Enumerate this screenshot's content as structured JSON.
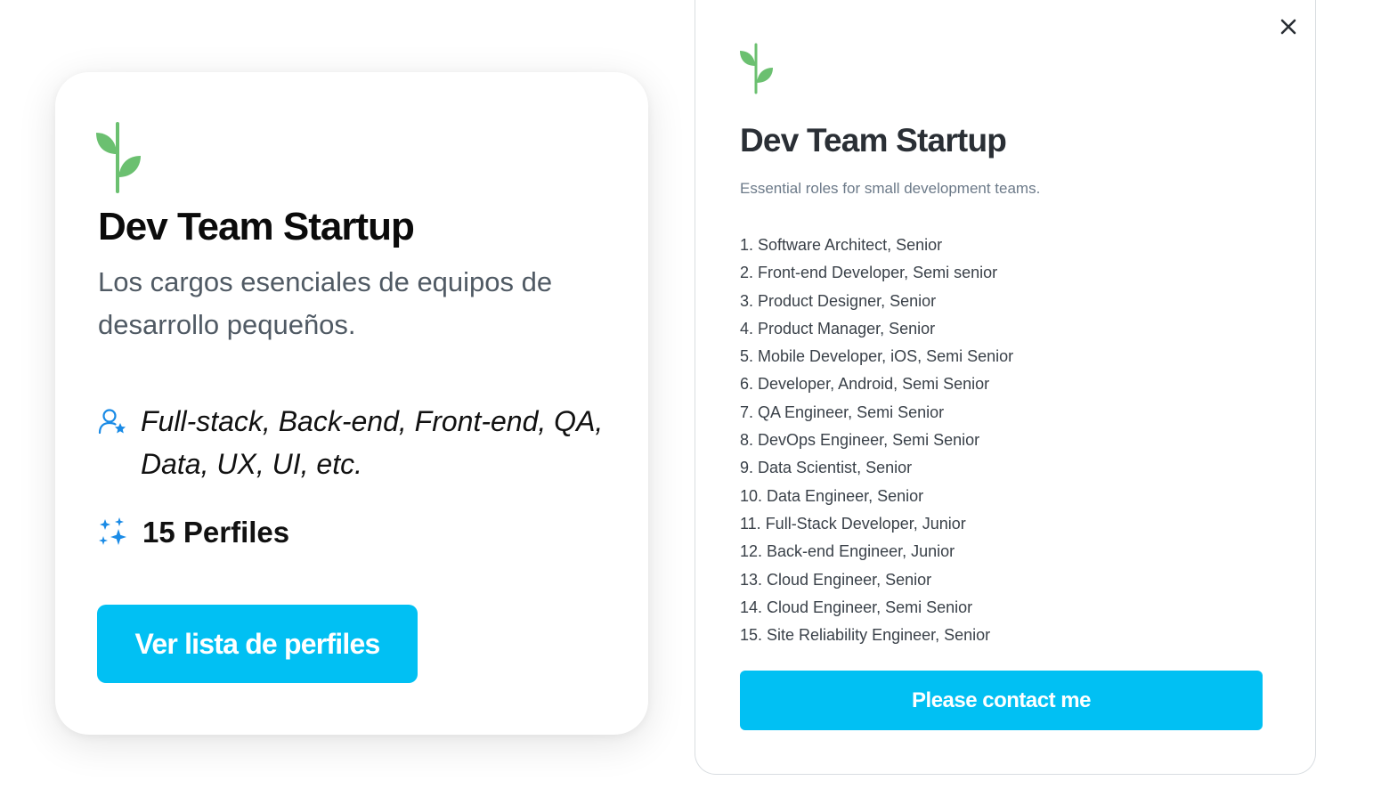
{
  "colors": {
    "accent": "#01c0f3",
    "leaf_green": "#6bc070",
    "icon_blue": "#1a8be6"
  },
  "card": {
    "logo_icon": "sprout-icon",
    "title": "Dev Team Startup",
    "description": "Los cargos esenciales de equipos de desarrollo pequeños.",
    "roles_icon": "user-star-icon",
    "roles": "Full-stack, Back-end, Front-end, QA, Data, UX, UI, etc.",
    "profiles_icon": "sparkles-icon",
    "profiles": "15 Perfiles",
    "button_label": "Ver lista de perfiles"
  },
  "modal": {
    "close_icon": "close-icon",
    "logo_icon": "sprout-icon",
    "title": "Dev Team Startup",
    "subtitle": "Essential roles for small development teams.",
    "roles": [
      "1. Software Architect, Senior",
      "2. Front-end Developer, Semi senior",
      "3. Product Designer, Senior",
      "4. Product Manager, Senior",
      "5. Mobile Developer, iOS, Semi Senior",
      "6. Developer, Android, Semi Senior",
      "7. QA Engineer, Semi Senior",
      "8. DevOps Engineer, Semi Senior",
      "9. Data Scientist, Senior",
      "10. Data Engineer, Senior",
      "11. Full-Stack Developer, Junior",
      "12. Back-end Engineer, Junior",
      "13. Cloud Engineer, Senior",
      "14. Cloud Engineer, Semi Senior",
      "15. Site Reliability Engineer, Senior"
    ],
    "button_label": "Please contact me"
  }
}
